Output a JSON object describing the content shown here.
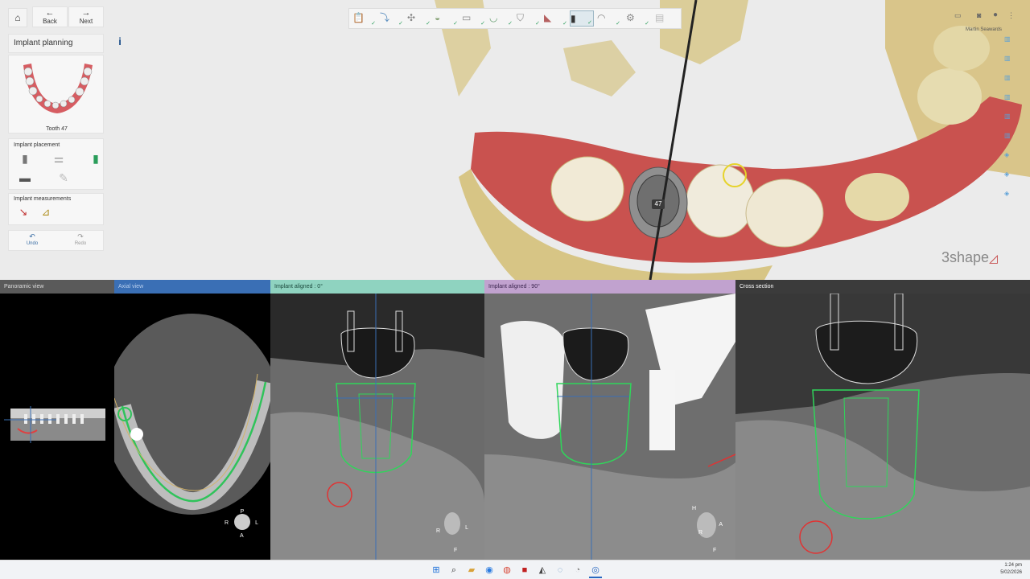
{
  "nav": {
    "home_icon": "home-icon",
    "back_label": "Back",
    "next_label": "Next"
  },
  "panel": {
    "title": "Implant planning",
    "info_label": "i",
    "tooth_label": "Tooth 47",
    "placement_title": "Implant placement",
    "measurements_title": "Implant measurements",
    "undo_label": "Undo",
    "redo_label": "Redo"
  },
  "scene": {
    "tooth_marker": "47",
    "user_name": "Martin Seawards",
    "brand": "3shape"
  },
  "views": [
    {
      "title": "Panoramic view",
      "color": "#5a5a5a"
    },
    {
      "title": "Axial view",
      "color": "#3a6fb5"
    },
    {
      "title": "Implant aligned : 0°",
      "color": "#8fd3c0"
    },
    {
      "title": "Implant aligned : 90°",
      "color": "#c1a2cf"
    },
    {
      "title": "Cross section",
      "color": "#3b3b3b"
    }
  ],
  "orientation": {
    "axial": {
      "top": "P",
      "left": "R",
      "right": "L",
      "bottom": "A"
    },
    "aligned0": {
      "left": "R",
      "right": "L",
      "bottom": "F"
    },
    "aligned90": {
      "top": "H",
      "left": "R",
      "right": "A",
      "bottom": "F"
    }
  },
  "taskbar": {
    "time": "1:24 pm",
    "date": "5/02/2026"
  },
  "colors": {
    "gum": "#c9524f",
    "bone": "#d8c98a",
    "implant_outline": "#27d65f",
    "accent": "#2a9d5a"
  }
}
